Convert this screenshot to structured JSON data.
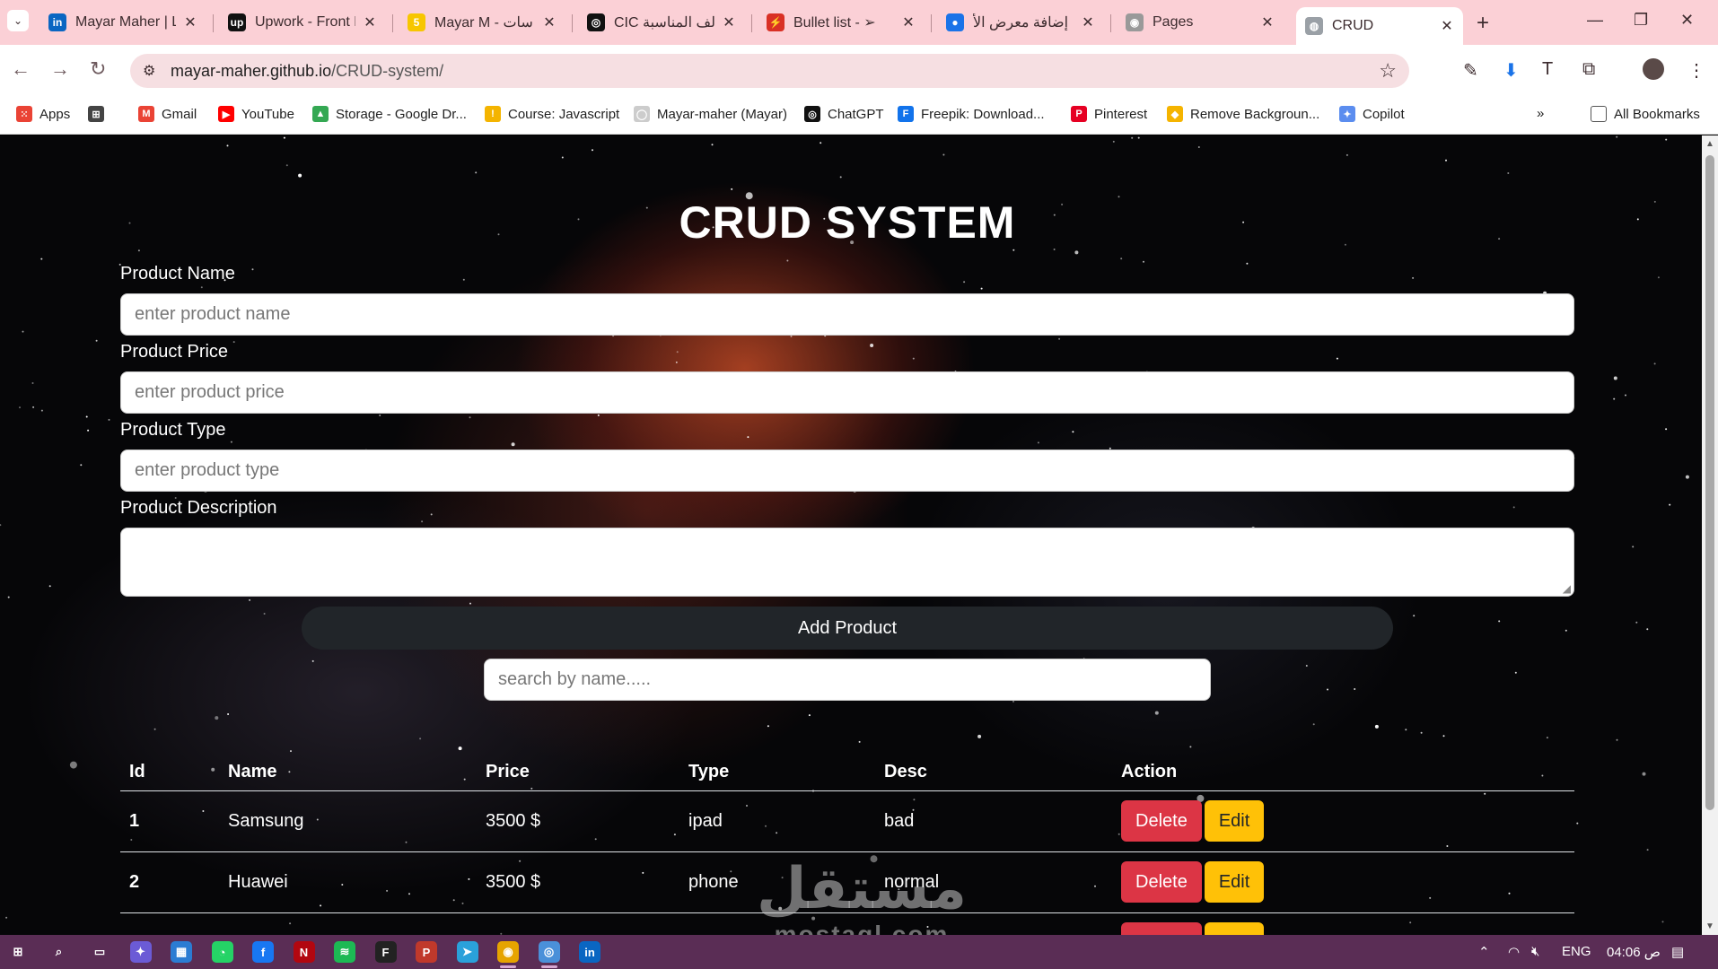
{
  "browser": {
    "tabs": [
      {
        "title": "Mayar Maher | L",
        "icon": "linkedin-icon",
        "color": "#0a66c2",
        "glyph": "in"
      },
      {
        "title": "Upwork - Front E",
        "icon": "upwork-icon",
        "color": "#111111",
        "glyph": "up"
      },
      {
        "title": "Mayar M - سات",
        "icon": "khamsat-icon",
        "color": "#f7c600",
        "glyph": "5"
      },
      {
        "title": "CIC الألف المناسبة",
        "icon": "chatgpt-icon",
        "color": "#111111",
        "glyph": "◎"
      },
      {
        "title": "Bullet list - ➢",
        "icon": "bolt-icon",
        "color": "#d93025",
        "glyph": "⚡"
      },
      {
        "title": "إضافة معرض الأ",
        "icon": "circle-icon",
        "color": "#1a73e8",
        "glyph": "●"
      },
      {
        "title": "Pages",
        "icon": "github-icon",
        "color": "#999999",
        "glyph": "◉"
      },
      {
        "title": "CRUD",
        "icon": "globe-icon",
        "color": "#9aa0a6",
        "glyph": "◍"
      }
    ],
    "url_host": "mayar-maher.github.io",
    "url_path": "/CRUD-system/",
    "bookmarks": [
      {
        "label": "Apps",
        "icon": "apps-grid-icon",
        "color": "#ea4335",
        "glyph": "⁙"
      },
      {
        "label": "",
        "icon": "grid-icon",
        "color": "#444444",
        "glyph": "⊞"
      },
      {
        "label": "Gmail",
        "icon": "gmail-icon",
        "color": "#ea4335",
        "glyph": "M"
      },
      {
        "label": "YouTube",
        "icon": "youtube-icon",
        "color": "#ff0000",
        "glyph": "▶"
      },
      {
        "label": "Storage - Google Dr...",
        "icon": "drive-icon",
        "color": "#34a853",
        "glyph": "▲"
      },
      {
        "label": "Course: Javascript",
        "icon": "course-icon",
        "color": "#f4b400",
        "glyph": "!"
      },
      {
        "label": "Mayar-maher (Mayar)",
        "icon": "github-icon",
        "color": "#cccccc",
        "glyph": "◯"
      },
      {
        "label": "ChatGPT",
        "icon": "chatgpt-icon",
        "color": "#111111",
        "glyph": "◎"
      },
      {
        "label": "Freepik: Download...",
        "icon": "freepik-icon",
        "color": "#1273eb",
        "glyph": "F"
      },
      {
        "label": "Pinterest",
        "icon": "pinterest-icon",
        "color": "#e60023",
        "glyph": "P"
      },
      {
        "label": "Remove Backgroun...",
        "icon": "removebg-icon",
        "color": "#f5b400",
        "glyph": "◆"
      },
      {
        "label": "Copilot",
        "icon": "copilot-icon",
        "color": "#5b8def",
        "glyph": "✦"
      }
    ],
    "all_bookmarks": "All Bookmarks"
  },
  "app": {
    "title": "CRUD SYSTEM",
    "fields": {
      "name_label": "Product Name",
      "name_placeholder": "enter product name",
      "price_label": "Product Price",
      "price_placeholder": "enter product price",
      "type_label": "Product Type",
      "type_placeholder": "enter product type",
      "desc_label": "Product Description",
      "desc_value": ""
    },
    "add_button": "Add Product",
    "search_placeholder": "search by name.....",
    "table": {
      "headers": [
        "Id",
        "Name",
        "Price",
        "Type",
        "Desc",
        "Action"
      ],
      "rows": [
        {
          "id": "1",
          "name": "Samsung",
          "price": "3500 $",
          "type": "ipad",
          "desc": "bad"
        },
        {
          "id": "2",
          "name": "Huawei",
          "price": "3500 $",
          "type": "phone",
          "desc": "normal"
        },
        {
          "id": "",
          "name": "",
          "price": "",
          "type": "",
          "desc": ""
        }
      ],
      "delete_label": "Delete",
      "edit_label": "Edit"
    }
  },
  "watermark": {
    "arabic": "مستقل",
    "latin": "mostaql.com"
  },
  "taskbar": {
    "apps": [
      "start-icon",
      "search-icon",
      "task-view-icon",
      "copilot-icon",
      "store-icon",
      "whatsapp-icon",
      "facebook-icon",
      "netflix-icon",
      "spotify-icon",
      "figma-icon",
      "pdf-icon",
      "telegram-icon",
      "chrome-icon",
      "app-icon",
      "linkedin-icon"
    ],
    "lang": "ENG",
    "time": "04:06",
    "ampm": "ص"
  },
  "colors": {
    "tabstrip": "#fbd0d6",
    "danger": "#dc3545",
    "warning": "#ffc107",
    "dark_button": "#212529",
    "taskbar": "#5a2d55"
  }
}
